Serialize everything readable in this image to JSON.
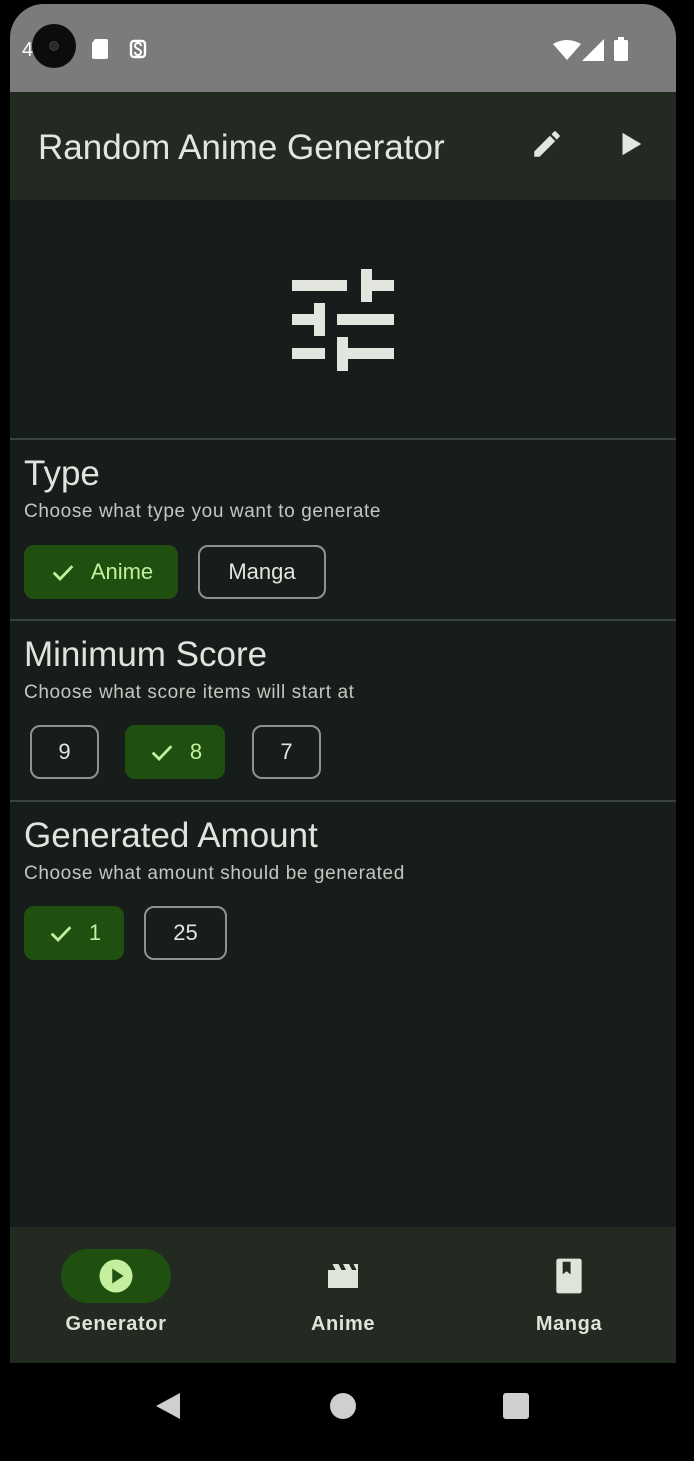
{
  "status_bar": {
    "time": "4",
    "icons": [
      "sd-card-icon",
      "subtitle-app-icon",
      "wifi-icon",
      "signal-icon",
      "battery-icon"
    ]
  },
  "app_bar": {
    "title": "Random Anime Generator",
    "actions": [
      {
        "name": "edit",
        "icon": "pencil-icon"
      },
      {
        "name": "play",
        "icon": "play-icon"
      }
    ]
  },
  "hero_icon": "tune-sliders-icon",
  "sections": {
    "type": {
      "title": "Type",
      "subtitle": "Choose what type you want to generate",
      "chips": [
        {
          "label": "Anime",
          "selected": true
        },
        {
          "label": "Manga",
          "selected": false
        }
      ]
    },
    "score": {
      "title": "Minimum Score",
      "subtitle": "Choose what score items will start at",
      "chips": [
        {
          "label": "9",
          "selected": false
        },
        {
          "label": "8",
          "selected": true
        },
        {
          "label": "7",
          "selected": false
        }
      ]
    },
    "amount": {
      "title": "Generated Amount",
      "subtitle": "Choose what amount should be generated",
      "chips": [
        {
          "label": "1",
          "selected": true
        },
        {
          "label": "25",
          "selected": false
        }
      ]
    }
  },
  "bottom_nav": {
    "items": [
      {
        "label": "Generator",
        "icon": "play-circle-icon",
        "active": true
      },
      {
        "label": "Anime",
        "icon": "clapperboard-icon",
        "active": false
      },
      {
        "label": "Manga",
        "icon": "book-icon",
        "active": false
      }
    ]
  },
  "system_nav": [
    "back-icon",
    "home-icon",
    "recents-icon"
  ],
  "colors": {
    "background": "#171d1a",
    "bar": "#232a22",
    "accent_container": "#1f5010",
    "accent_on_container": "#c3ef9e",
    "status_bar": "#7b7b7b"
  }
}
